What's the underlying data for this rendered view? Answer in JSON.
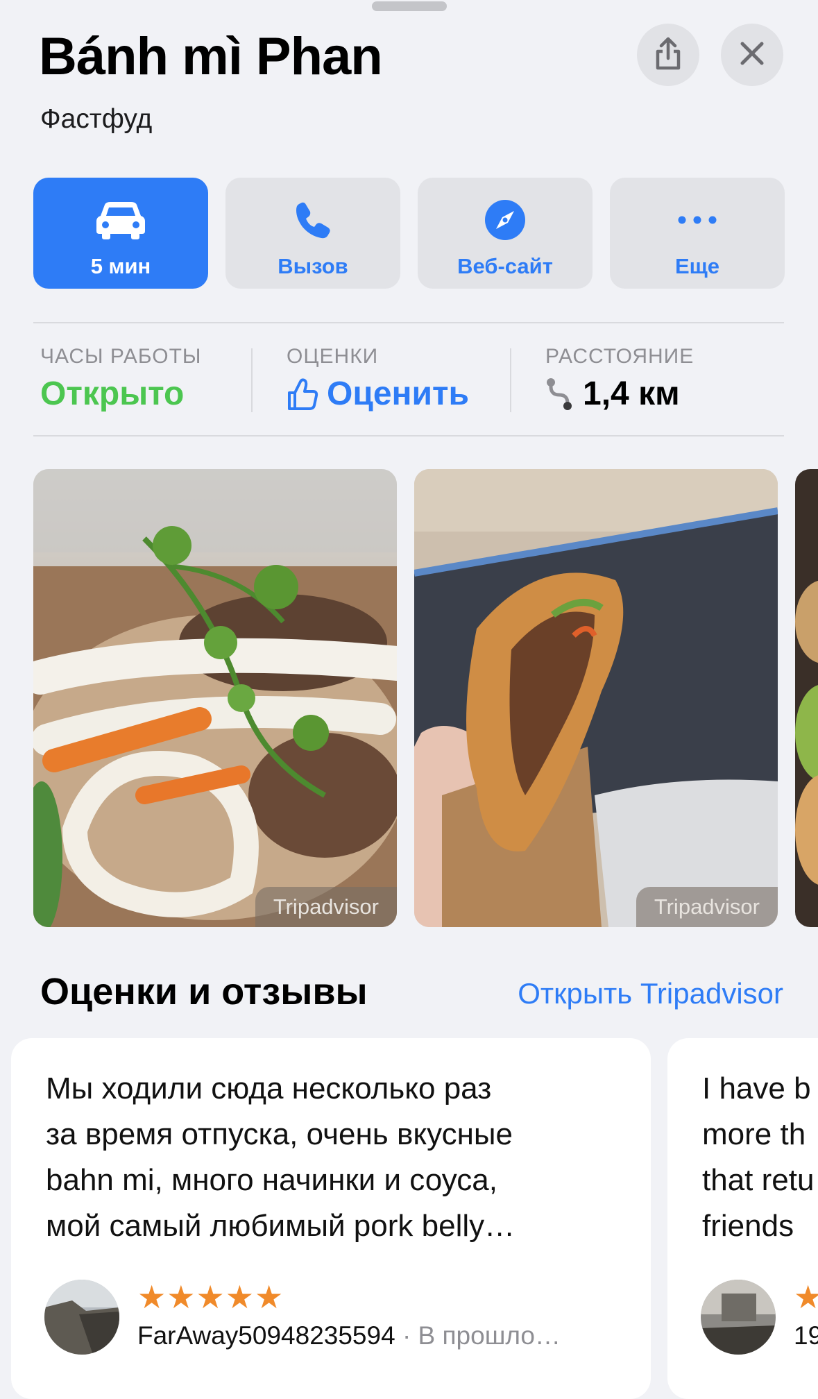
{
  "place": {
    "name": "Bánh mì Phan",
    "category": "Фастфуд"
  },
  "header_buttons": {
    "share_icon": "share-icon",
    "close_icon": "close-icon"
  },
  "actions": [
    {
      "label": "5 мин",
      "icon": "car-icon",
      "primary": true
    },
    {
      "label": "Вызов",
      "icon": "phone-icon",
      "primary": false
    },
    {
      "label": "Веб-сайт",
      "icon": "compass-icon",
      "primary": false
    },
    {
      "label": "Еще",
      "icon": "more-icon",
      "primary": false
    }
  ],
  "info": {
    "hours": {
      "heading": "ЧАСЫ РАБОТЫ",
      "value": "Открыто",
      "color": "#4cc650"
    },
    "ratings": {
      "heading": "ОЦЕНКИ",
      "value": "Оценить",
      "color": "#2e7cf6"
    },
    "distance": {
      "heading": "РАССТОЯНИЕ",
      "value": "1,4 км"
    }
  },
  "photos": [
    {
      "source": "Tripadvisor"
    },
    {
      "source": "Tripadvisor"
    }
  ],
  "reviews_section": {
    "title": "Оценки и отзывы",
    "link": "Открыть Tripadvisor"
  },
  "reviews": [
    {
      "lines": [
        "Мы ходили сюда несколько раз",
        "за время отпуска, очень вкусные",
        "bahn mi, много начинки и соуса,",
        "мой самый любимый pork belly…"
      ],
      "stars": "★★★★★",
      "rating": 5,
      "author": "FarAway50948235594",
      "when": " · В прошло…"
    },
    {
      "lines": [
        "I have b",
        "more th",
        "that retu",
        "friends"
      ],
      "stars": "★",
      "author": "19"
    }
  ],
  "colors": {
    "accent": "#2e7cf6",
    "open": "#4cc650",
    "star": "#f08a2a"
  }
}
